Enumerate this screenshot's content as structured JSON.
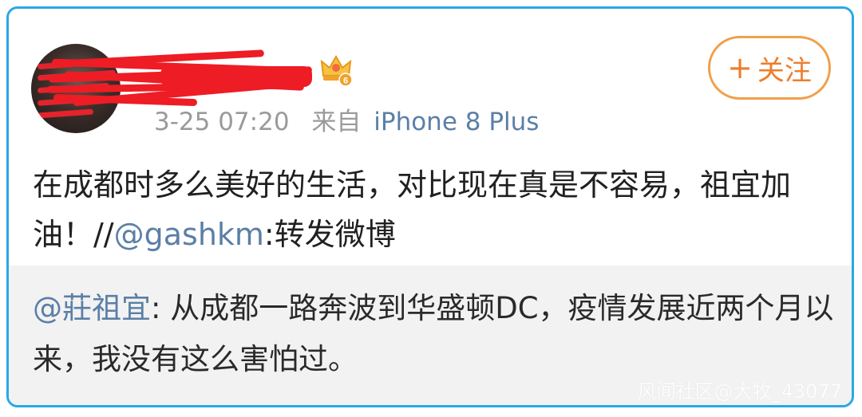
{
  "post": {
    "timestamp": "3-25 07:20",
    "source_label": "来自",
    "source_device": "iPhone 8 Plus",
    "follow_plus": "+",
    "follow_label": "关注",
    "vip_level": "6",
    "text_before_mention": "在成都时多么美好的生活，对比现在真是不容易，祖宜加油！//",
    "mention": "@gashkm",
    "text_after_mention": ":转发微博"
  },
  "quoted": {
    "mention": "@莊祖宜",
    "text": ": 从成都一路奔波到华盛顿DC，疫情发展近两个月以来，我没有这么害怕过。"
  },
  "watermark": "风闻社区@大牧_43077",
  "colors": {
    "frame_border": "#29a8e6",
    "follow_orange": "#ee7d2b",
    "link_blue": "#5b7fa6",
    "quoted_bg": "#f2f2f2"
  }
}
